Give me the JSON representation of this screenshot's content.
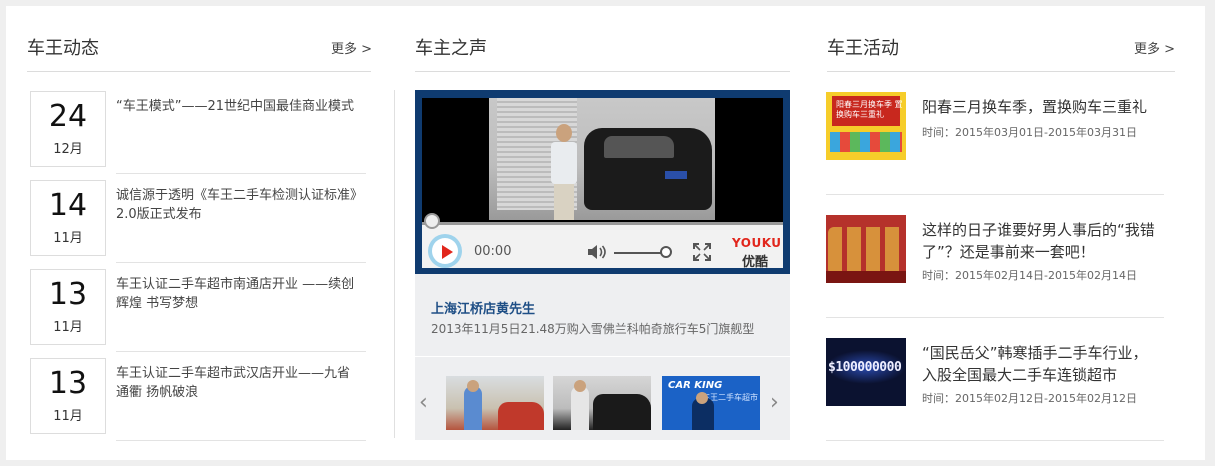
{
  "news": {
    "title": "车王动态",
    "more": "更多 >",
    "items": [
      {
        "day": "24",
        "month": "12月",
        "text": "“车王模式”——21世纪中国最佳商业模式"
      },
      {
        "day": "14",
        "month": "11月",
        "text": "诚信源于透明《车王二手车检测认证标准》2.0版正式发布"
      },
      {
        "day": "13",
        "month": "11月",
        "text": "车王认证二手车超市南通店开业 ——续创辉煌 书写梦想"
      },
      {
        "day": "13",
        "month": "11月",
        "text": "车王认证二手车超市武汉店开业——九省通衢 扬帆破浪"
      }
    ]
  },
  "voice": {
    "title": "车主之声",
    "player": {
      "time": "00:00",
      "logo_en": "YOUKU",
      "logo_cn": "优酷",
      "progress": 0,
      "volume": 0.9
    },
    "owner_name": "上海江桥店黄先生",
    "owner_desc": "2013年11月5日21.48万购入雪佛兰科帕奇旅行车5门旗舰型",
    "thumb3_brand": "CAR KING",
    "thumb3_sub": "车王二手车超市",
    "prev_arrow": "‹",
    "next_arrow": "›"
  },
  "activities": {
    "title": "车王活动",
    "more": "更多 >",
    "items": [
      {
        "title": "阳春三月换车季，置换购车三重礼",
        "time": "时间：2015年03月01日-2015年03月31日",
        "image_text": "阳春三月换车季 置换购车三重礼"
      },
      {
        "title": "这样的日子谁要好男人事后的“我错了”？还是事前来一套吧！",
        "time": "时间：2015年02月14日-2015年02月14日"
      },
      {
        "title": "“国民岳父”韩寒插手二手车行业，入股全国最大二手车连锁超市",
        "time": "时间：2015年02月12日-2015年02月12日",
        "image_text": "$100000000"
      }
    ]
  }
}
